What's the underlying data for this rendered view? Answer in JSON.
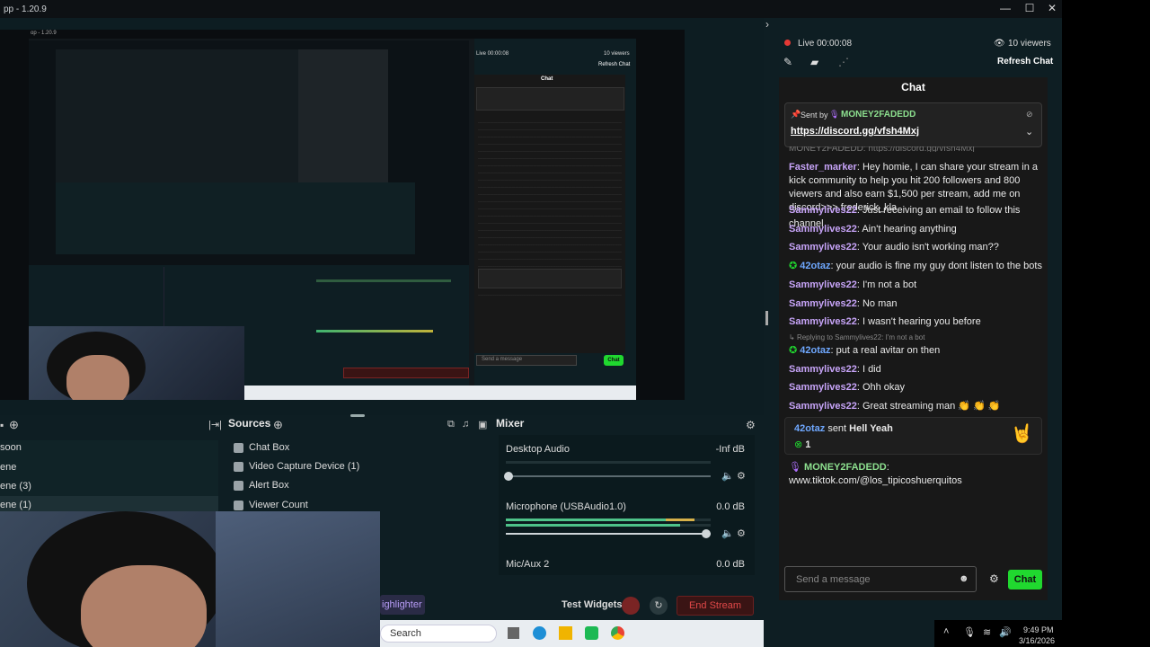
{
  "window": {
    "title": "pp - 1.20.9",
    "controls": [
      "—",
      "☐",
      "✕"
    ]
  },
  "nested_title": "op - 1.20.9",
  "nested_chat": {
    "live": "Live 00:00:08",
    "viewers": "10 viewers",
    "refresh": "Refresh Chat",
    "title": "Chat",
    "send_placeholder": "Send a message",
    "chat_btn": "Chat"
  },
  "dock": {
    "sources_title": "Sources",
    "mixer_title": "Mixer",
    "scenes": [
      "soon",
      "ene",
      "ene (3)",
      "ene (1)"
    ],
    "sources": [
      {
        "icon": "window-icon",
        "label": "Chat Box"
      },
      {
        "icon": "camera-icon",
        "label": "Video Capture Device (1)"
      },
      {
        "icon": "bell-icon",
        "label": "Alert Box"
      },
      {
        "icon": "eye-icon",
        "label": "Viewer Count"
      }
    ],
    "mixer": [
      {
        "name": "Desktop Audio",
        "level": "-Inf dB"
      },
      {
        "name": "Microphone (USBAudio1.0)",
        "level": "0.0 dB"
      },
      {
        "name": "Mic/Aux 2",
        "level": "0.0 dB"
      }
    ],
    "highlighter": "ighlighter",
    "test_widgets": "Test Widgets",
    "end_stream": "End Stream"
  },
  "taskbar": {
    "search": "Search",
    "time": "9:49 PM",
    "date": "3/16/2026"
  },
  "right": {
    "live": "Live 00:00:08",
    "viewers": "10 viewers",
    "refresh": "Refresh Chat",
    "chat_title": "Chat",
    "pinned": {
      "sent_by": "Sent by",
      "user": "MONEY2FADEDD",
      "link": "https://discord.gg/vfsh4Mxj",
      "partial": "MONEY2FADEDD: https://discord.gg/vfsh4Mxj"
    },
    "messages": [
      {
        "user": "Faster_marker",
        "text": ": Hey homie, I can share your stream in a kick community to help you hit 200 followers and 800 viewers and also earn $1,500 per stream, add me on discord>>> frederick_kla"
      },
      {
        "user": "Sammylives22",
        "text": ": Just receiving an email to follow this channel"
      },
      {
        "user": "Sammylives22",
        "text": ": Ain't hearing anything"
      },
      {
        "user": "Sammylives22",
        "text": ": Your audio isn't working man??"
      },
      {
        "user": "42otaz",
        "text": ": your audio is fine my guy dont listen to the bots"
      },
      {
        "user": "Sammylives22",
        "text": ": I'm not a bot"
      },
      {
        "user": "Sammylives22",
        "text": ": No man"
      },
      {
        "user": "Sammylives22",
        "text": ": I wasn't hearing you before"
      },
      {
        "user": "42otaz",
        "text": ": put a real avitar on then",
        "reply": "Replying to Sammylives22: I'm not a bot"
      },
      {
        "user": "Sammylives22",
        "text": ": I did"
      },
      {
        "user": "Sammylives22",
        "text": ": Ohh okay"
      },
      {
        "user": "Sammylives22",
        "text": ": Great streaming man 👏 👏 👏"
      }
    ],
    "gift": {
      "user": "42otaz",
      "sent": "sent",
      "item": "Hell Yeah",
      "count": "1"
    },
    "last": {
      "user": "MONEY2FADEDD",
      "text": ": www.tiktok.com/@los_tipicoshuerquitos"
    },
    "send_placeholder": "Send a message",
    "chat_btn": "Chat"
  },
  "colors": {
    "accent": "#20d82f",
    "purple": "#c7a4f8",
    "blue": "#6fa8ff",
    "live": "#e53935",
    "end": "#e04848"
  }
}
